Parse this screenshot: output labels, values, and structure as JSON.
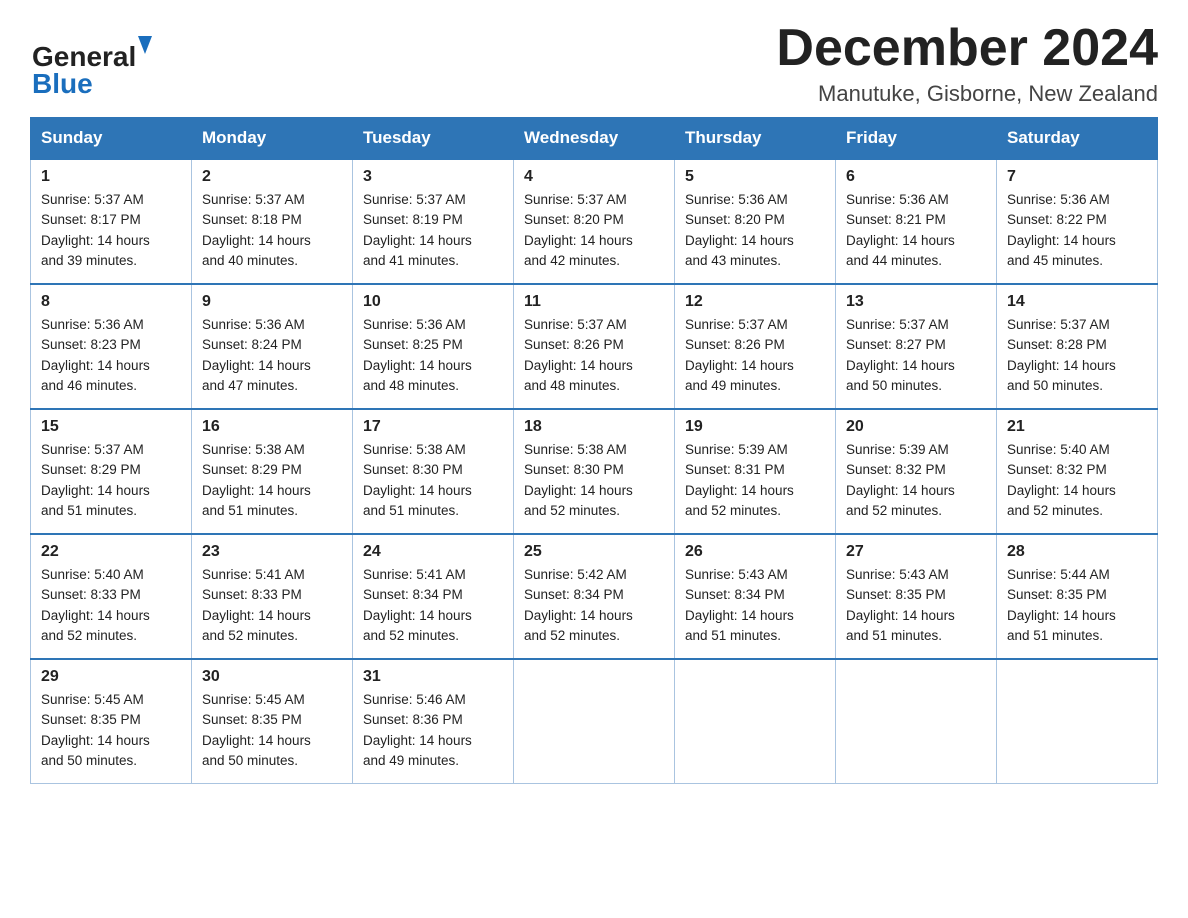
{
  "header": {
    "logo_line1": "General",
    "logo_line2": "Blue",
    "month_title": "December 2024",
    "location": "Manutuke, Gisborne, New Zealand"
  },
  "days_of_week": [
    "Sunday",
    "Monday",
    "Tuesday",
    "Wednesday",
    "Thursday",
    "Friday",
    "Saturday"
  ],
  "weeks": [
    [
      {
        "day": "1",
        "sunrise": "5:37 AM",
        "sunset": "8:17 PM",
        "daylight": "14 hours and 39 minutes."
      },
      {
        "day": "2",
        "sunrise": "5:37 AM",
        "sunset": "8:18 PM",
        "daylight": "14 hours and 40 minutes."
      },
      {
        "day": "3",
        "sunrise": "5:37 AM",
        "sunset": "8:19 PM",
        "daylight": "14 hours and 41 minutes."
      },
      {
        "day": "4",
        "sunrise": "5:37 AM",
        "sunset": "8:20 PM",
        "daylight": "14 hours and 42 minutes."
      },
      {
        "day": "5",
        "sunrise": "5:36 AM",
        "sunset": "8:20 PM",
        "daylight": "14 hours and 43 minutes."
      },
      {
        "day": "6",
        "sunrise": "5:36 AM",
        "sunset": "8:21 PM",
        "daylight": "14 hours and 44 minutes."
      },
      {
        "day": "7",
        "sunrise": "5:36 AM",
        "sunset": "8:22 PM",
        "daylight": "14 hours and 45 minutes."
      }
    ],
    [
      {
        "day": "8",
        "sunrise": "5:36 AM",
        "sunset": "8:23 PM",
        "daylight": "14 hours and 46 minutes."
      },
      {
        "day": "9",
        "sunrise": "5:36 AM",
        "sunset": "8:24 PM",
        "daylight": "14 hours and 47 minutes."
      },
      {
        "day": "10",
        "sunrise": "5:36 AM",
        "sunset": "8:25 PM",
        "daylight": "14 hours and 48 minutes."
      },
      {
        "day": "11",
        "sunrise": "5:37 AM",
        "sunset": "8:26 PM",
        "daylight": "14 hours and 48 minutes."
      },
      {
        "day": "12",
        "sunrise": "5:37 AM",
        "sunset": "8:26 PM",
        "daylight": "14 hours and 49 minutes."
      },
      {
        "day": "13",
        "sunrise": "5:37 AM",
        "sunset": "8:27 PM",
        "daylight": "14 hours and 50 minutes."
      },
      {
        "day": "14",
        "sunrise": "5:37 AM",
        "sunset": "8:28 PM",
        "daylight": "14 hours and 50 minutes."
      }
    ],
    [
      {
        "day": "15",
        "sunrise": "5:37 AM",
        "sunset": "8:29 PM",
        "daylight": "14 hours and 51 minutes."
      },
      {
        "day": "16",
        "sunrise": "5:38 AM",
        "sunset": "8:29 PM",
        "daylight": "14 hours and 51 minutes."
      },
      {
        "day": "17",
        "sunrise": "5:38 AM",
        "sunset": "8:30 PM",
        "daylight": "14 hours and 51 minutes."
      },
      {
        "day": "18",
        "sunrise": "5:38 AM",
        "sunset": "8:30 PM",
        "daylight": "14 hours and 52 minutes."
      },
      {
        "day": "19",
        "sunrise": "5:39 AM",
        "sunset": "8:31 PM",
        "daylight": "14 hours and 52 minutes."
      },
      {
        "day": "20",
        "sunrise": "5:39 AM",
        "sunset": "8:32 PM",
        "daylight": "14 hours and 52 minutes."
      },
      {
        "day": "21",
        "sunrise": "5:40 AM",
        "sunset": "8:32 PM",
        "daylight": "14 hours and 52 minutes."
      }
    ],
    [
      {
        "day": "22",
        "sunrise": "5:40 AM",
        "sunset": "8:33 PM",
        "daylight": "14 hours and 52 minutes."
      },
      {
        "day": "23",
        "sunrise": "5:41 AM",
        "sunset": "8:33 PM",
        "daylight": "14 hours and 52 minutes."
      },
      {
        "day": "24",
        "sunrise": "5:41 AM",
        "sunset": "8:34 PM",
        "daylight": "14 hours and 52 minutes."
      },
      {
        "day": "25",
        "sunrise": "5:42 AM",
        "sunset": "8:34 PM",
        "daylight": "14 hours and 52 minutes."
      },
      {
        "day": "26",
        "sunrise": "5:43 AM",
        "sunset": "8:34 PM",
        "daylight": "14 hours and 51 minutes."
      },
      {
        "day": "27",
        "sunrise": "5:43 AM",
        "sunset": "8:35 PM",
        "daylight": "14 hours and 51 minutes."
      },
      {
        "day": "28",
        "sunrise": "5:44 AM",
        "sunset": "8:35 PM",
        "daylight": "14 hours and 51 minutes."
      }
    ],
    [
      {
        "day": "29",
        "sunrise": "5:45 AM",
        "sunset": "8:35 PM",
        "daylight": "14 hours and 50 minutes."
      },
      {
        "day": "30",
        "sunrise": "5:45 AM",
        "sunset": "8:35 PM",
        "daylight": "14 hours and 50 minutes."
      },
      {
        "day": "31",
        "sunrise": "5:46 AM",
        "sunset": "8:36 PM",
        "daylight": "14 hours and 49 minutes."
      },
      null,
      null,
      null,
      null
    ]
  ],
  "labels": {
    "sunrise_prefix": "Sunrise: ",
    "sunset_prefix": "Sunset: ",
    "daylight_prefix": "Daylight: "
  }
}
